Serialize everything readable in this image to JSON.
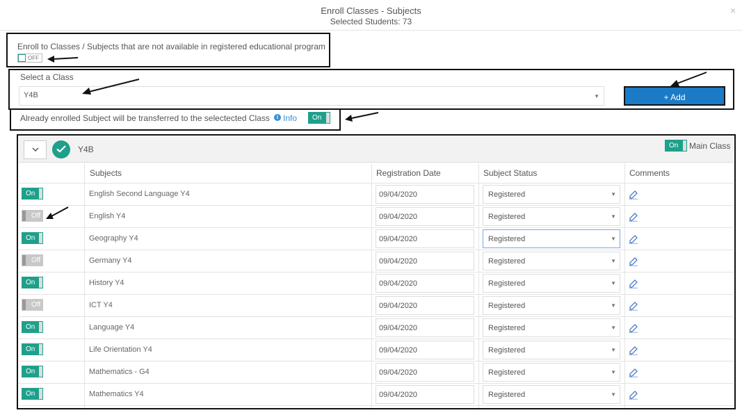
{
  "modal": {
    "title": "Enroll Classes - Subjects",
    "subtitle": "Selected Students: 73",
    "close": "×"
  },
  "enroll_unavailable": {
    "label": "Enroll to Classes / Subjects that are not available in registered educational program",
    "toggle": "OFF"
  },
  "select_class": {
    "label": "Select a Class",
    "value": "Y4B"
  },
  "add_button": {
    "icon": "+",
    "label": "Add"
  },
  "transfer": {
    "label": "Already enrolled Subject will be transferred to the selectected Class",
    "info": "Info",
    "toggle": "On"
  },
  "panel": {
    "class_name": "Y4B",
    "main_class_toggle": "On",
    "main_class_label": "Main Class"
  },
  "table": {
    "headers": [
      "Subjects",
      "Registration Date",
      "Subject Status",
      "Comments"
    ],
    "rows": [
      {
        "toggle": "On",
        "subject": "English Second Language Y4",
        "date": "09/04/2020",
        "status": "Registered"
      },
      {
        "toggle": "Off",
        "subject": "English Y4",
        "date": "09/04/2020",
        "status": "Registered"
      },
      {
        "toggle": "On",
        "subject": "Geography Y4",
        "date": "09/04/2020",
        "status": "Registered"
      },
      {
        "toggle": "Off",
        "subject": "Germany Y4",
        "date": "09/04/2020",
        "status": "Registered"
      },
      {
        "toggle": "On",
        "subject": "History Y4",
        "date": "09/04/2020",
        "status": "Registered"
      },
      {
        "toggle": "Off",
        "subject": "ICT Y4",
        "date": "09/04/2020",
        "status": "Registered"
      },
      {
        "toggle": "On",
        "subject": "Language Y4",
        "date": "09/04/2020",
        "status": "Registered"
      },
      {
        "toggle": "On",
        "subject": "Life Orientation Y4",
        "date": "09/04/2020",
        "status": "Registered"
      },
      {
        "toggle": "On",
        "subject": "Mathematics - G4",
        "date": "09/04/2020",
        "status": "Registered"
      },
      {
        "toggle": "On",
        "subject": "Mathematics Y4",
        "date": "09/04/2020",
        "status": "Registered"
      }
    ]
  },
  "colors": {
    "toggle_on": "#1ea08a",
    "toggle_off": "#c8c8c8",
    "add_button": "#1b7bc6",
    "info_link": "#3a8fd6"
  },
  "icons": {
    "close": "close-icon",
    "chevron": "chevron-down-icon",
    "check": "check-circle-icon",
    "info": "info-icon",
    "edit": "edit-icon",
    "arrow": "annotation-arrow-icon"
  }
}
